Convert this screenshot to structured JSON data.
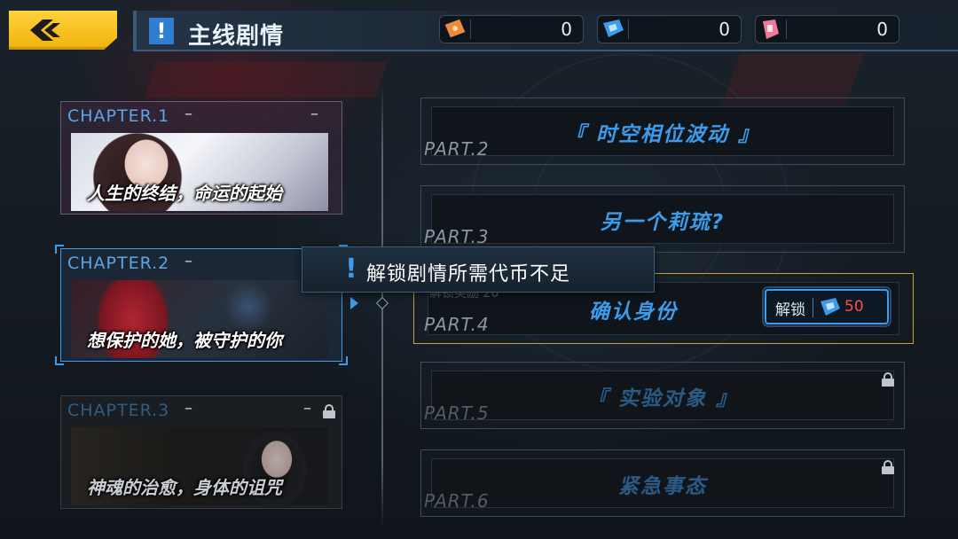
{
  "header": {
    "back_icon": "chevron-left-icon",
    "title_icon": "exclamation-icon",
    "title": "主线剧情",
    "currencies": [
      {
        "icon": "orange-ticket-icon",
        "value": "0"
      },
      {
        "icon": "blue-crystal-icon",
        "value": "0"
      },
      {
        "icon": "pink-ticket-icon",
        "value": "0"
      }
    ]
  },
  "chapters": [
    {
      "label": "CHAPTER.1",
      "subtitle": "人生的终结，命运的起始",
      "locked": false
    },
    {
      "label": "CHAPTER.2",
      "subtitle": "想保护的她，被守护的你",
      "locked": false,
      "selected": true
    },
    {
      "label": "CHAPTER.3",
      "subtitle": "神魂的治愈，身体的诅咒",
      "locked": true
    }
  ],
  "parts": [
    {
      "label": "PART.2",
      "title": "『 时空相位波动 』",
      "locked": false
    },
    {
      "label": "PART.3",
      "title": "另一个莉琉?",
      "locked": false
    },
    {
      "label": "PART.4",
      "title": "确认身份",
      "locked": false,
      "ghost": "解锁奖励",
      "ghost_value": "20"
    },
    {
      "label": "PART.5",
      "title": "『 实验对象 』",
      "locked": true
    },
    {
      "label": "PART.6",
      "title": "紧急事态",
      "locked": true
    }
  ],
  "unlock_button": {
    "label": "解锁",
    "icon": "blue-crystal-icon",
    "cost": "50"
  },
  "toast": {
    "icon": "exclamation-icon",
    "message": "解锁剧情所需代币不足"
  },
  "colors": {
    "accent_blue": "#3d9be9",
    "gold": "#f0b20a",
    "cost_red": "#ff4c4c"
  }
}
